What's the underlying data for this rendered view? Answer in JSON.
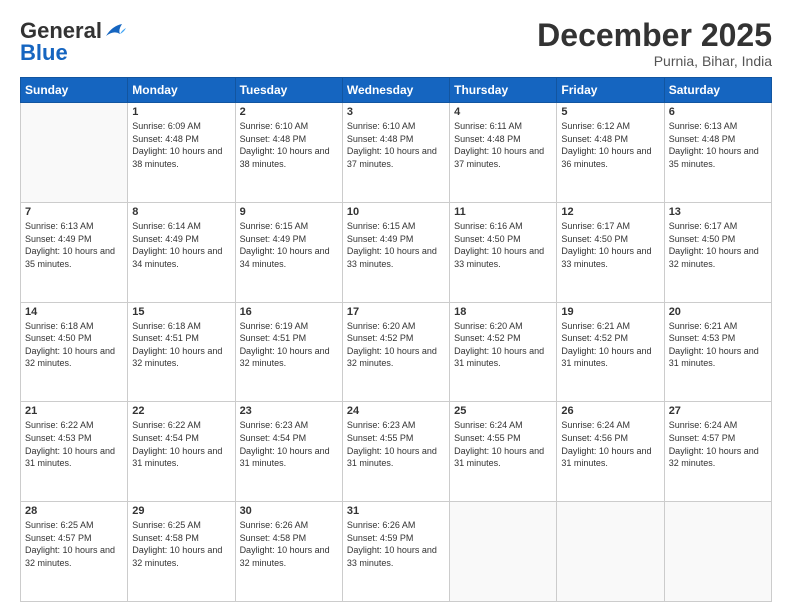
{
  "header": {
    "logo_general": "General",
    "logo_blue": "Blue",
    "month_title": "December 2025",
    "subtitle": "Purnia, Bihar, India"
  },
  "days_of_week": [
    "Sunday",
    "Monday",
    "Tuesday",
    "Wednesday",
    "Thursday",
    "Friday",
    "Saturday"
  ],
  "weeks": [
    [
      {
        "day": "",
        "empty": true
      },
      {
        "day": "1",
        "sunrise": "Sunrise: 6:09 AM",
        "sunset": "Sunset: 4:48 PM",
        "daylight": "Daylight: 10 hours and 38 minutes."
      },
      {
        "day": "2",
        "sunrise": "Sunrise: 6:10 AM",
        "sunset": "Sunset: 4:48 PM",
        "daylight": "Daylight: 10 hours and 38 minutes."
      },
      {
        "day": "3",
        "sunrise": "Sunrise: 6:10 AM",
        "sunset": "Sunset: 4:48 PM",
        "daylight": "Daylight: 10 hours and 37 minutes."
      },
      {
        "day": "4",
        "sunrise": "Sunrise: 6:11 AM",
        "sunset": "Sunset: 4:48 PM",
        "daylight": "Daylight: 10 hours and 37 minutes."
      },
      {
        "day": "5",
        "sunrise": "Sunrise: 6:12 AM",
        "sunset": "Sunset: 4:48 PM",
        "daylight": "Daylight: 10 hours and 36 minutes."
      },
      {
        "day": "6",
        "sunrise": "Sunrise: 6:13 AM",
        "sunset": "Sunset: 4:48 PM",
        "daylight": "Daylight: 10 hours and 35 minutes."
      }
    ],
    [
      {
        "day": "7",
        "sunrise": "Sunrise: 6:13 AM",
        "sunset": "Sunset: 4:49 PM",
        "daylight": "Daylight: 10 hours and 35 minutes."
      },
      {
        "day": "8",
        "sunrise": "Sunrise: 6:14 AM",
        "sunset": "Sunset: 4:49 PM",
        "daylight": "Daylight: 10 hours and 34 minutes."
      },
      {
        "day": "9",
        "sunrise": "Sunrise: 6:15 AM",
        "sunset": "Sunset: 4:49 PM",
        "daylight": "Daylight: 10 hours and 34 minutes."
      },
      {
        "day": "10",
        "sunrise": "Sunrise: 6:15 AM",
        "sunset": "Sunset: 4:49 PM",
        "daylight": "Daylight: 10 hours and 33 minutes."
      },
      {
        "day": "11",
        "sunrise": "Sunrise: 6:16 AM",
        "sunset": "Sunset: 4:50 PM",
        "daylight": "Daylight: 10 hours and 33 minutes."
      },
      {
        "day": "12",
        "sunrise": "Sunrise: 6:17 AM",
        "sunset": "Sunset: 4:50 PM",
        "daylight": "Daylight: 10 hours and 33 minutes."
      },
      {
        "day": "13",
        "sunrise": "Sunrise: 6:17 AM",
        "sunset": "Sunset: 4:50 PM",
        "daylight": "Daylight: 10 hours and 32 minutes."
      }
    ],
    [
      {
        "day": "14",
        "sunrise": "Sunrise: 6:18 AM",
        "sunset": "Sunset: 4:50 PM",
        "daylight": "Daylight: 10 hours and 32 minutes."
      },
      {
        "day": "15",
        "sunrise": "Sunrise: 6:18 AM",
        "sunset": "Sunset: 4:51 PM",
        "daylight": "Daylight: 10 hours and 32 minutes."
      },
      {
        "day": "16",
        "sunrise": "Sunrise: 6:19 AM",
        "sunset": "Sunset: 4:51 PM",
        "daylight": "Daylight: 10 hours and 32 minutes."
      },
      {
        "day": "17",
        "sunrise": "Sunrise: 6:20 AM",
        "sunset": "Sunset: 4:52 PM",
        "daylight": "Daylight: 10 hours and 32 minutes."
      },
      {
        "day": "18",
        "sunrise": "Sunrise: 6:20 AM",
        "sunset": "Sunset: 4:52 PM",
        "daylight": "Daylight: 10 hours and 31 minutes."
      },
      {
        "day": "19",
        "sunrise": "Sunrise: 6:21 AM",
        "sunset": "Sunset: 4:52 PM",
        "daylight": "Daylight: 10 hours and 31 minutes."
      },
      {
        "day": "20",
        "sunrise": "Sunrise: 6:21 AM",
        "sunset": "Sunset: 4:53 PM",
        "daylight": "Daylight: 10 hours and 31 minutes."
      }
    ],
    [
      {
        "day": "21",
        "sunrise": "Sunrise: 6:22 AM",
        "sunset": "Sunset: 4:53 PM",
        "daylight": "Daylight: 10 hours and 31 minutes."
      },
      {
        "day": "22",
        "sunrise": "Sunrise: 6:22 AM",
        "sunset": "Sunset: 4:54 PM",
        "daylight": "Daylight: 10 hours and 31 minutes."
      },
      {
        "day": "23",
        "sunrise": "Sunrise: 6:23 AM",
        "sunset": "Sunset: 4:54 PM",
        "daylight": "Daylight: 10 hours and 31 minutes."
      },
      {
        "day": "24",
        "sunrise": "Sunrise: 6:23 AM",
        "sunset": "Sunset: 4:55 PM",
        "daylight": "Daylight: 10 hours and 31 minutes."
      },
      {
        "day": "25",
        "sunrise": "Sunrise: 6:24 AM",
        "sunset": "Sunset: 4:55 PM",
        "daylight": "Daylight: 10 hours and 31 minutes."
      },
      {
        "day": "26",
        "sunrise": "Sunrise: 6:24 AM",
        "sunset": "Sunset: 4:56 PM",
        "daylight": "Daylight: 10 hours and 31 minutes."
      },
      {
        "day": "27",
        "sunrise": "Sunrise: 6:24 AM",
        "sunset": "Sunset: 4:57 PM",
        "daylight": "Daylight: 10 hours and 32 minutes."
      }
    ],
    [
      {
        "day": "28",
        "sunrise": "Sunrise: 6:25 AM",
        "sunset": "Sunset: 4:57 PM",
        "daylight": "Daylight: 10 hours and 32 minutes."
      },
      {
        "day": "29",
        "sunrise": "Sunrise: 6:25 AM",
        "sunset": "Sunset: 4:58 PM",
        "daylight": "Daylight: 10 hours and 32 minutes."
      },
      {
        "day": "30",
        "sunrise": "Sunrise: 6:26 AM",
        "sunset": "Sunset: 4:58 PM",
        "daylight": "Daylight: 10 hours and 32 minutes."
      },
      {
        "day": "31",
        "sunrise": "Sunrise: 6:26 AM",
        "sunset": "Sunset: 4:59 PM",
        "daylight": "Daylight: 10 hours and 33 minutes."
      },
      {
        "day": "",
        "empty": true
      },
      {
        "day": "",
        "empty": true
      },
      {
        "day": "",
        "empty": true
      }
    ]
  ]
}
